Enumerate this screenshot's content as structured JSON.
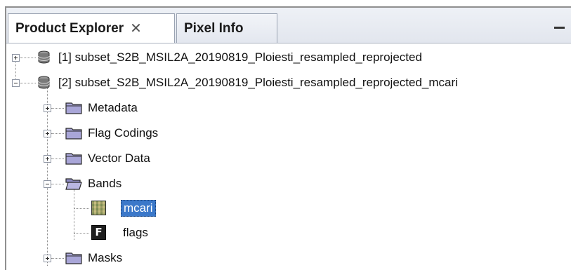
{
  "tabs": [
    {
      "label": "Product Explorer",
      "close_icon": "✕"
    },
    {
      "label": "Pixel Info"
    }
  ],
  "tree": {
    "products": [
      {
        "label": "[1] subset_S2B_MSIL2A_20190819_Ploiesti_resampled_reprojected",
        "expanded": false
      },
      {
        "label": "[2] subset_S2B_MSIL2A_20190819_Ploiesti_resampled_reprojected_mcari",
        "expanded": true
      }
    ],
    "groups": [
      {
        "label": "Metadata",
        "expanded": false
      },
      {
        "label": "Flag Codings",
        "expanded": false
      },
      {
        "label": "Vector Data",
        "expanded": false
      },
      {
        "label": "Bands",
        "expanded": true
      },
      {
        "label": "Masks",
        "expanded": false
      }
    ],
    "bands": [
      {
        "label": "mcari",
        "selected": true,
        "icon": "raster-band-icon"
      },
      {
        "label": "flags",
        "selected": false,
        "icon": "flag-band-icon",
        "icon_letter": "F"
      }
    ]
  },
  "colors": {
    "selection": "#3b78c9",
    "folder": "#a9a6d8",
    "tab_bar": "#e6e9f0"
  }
}
